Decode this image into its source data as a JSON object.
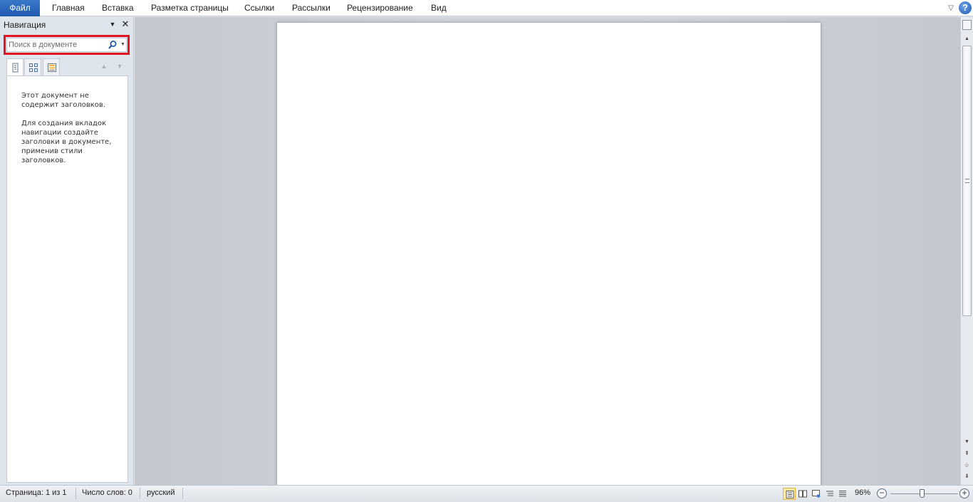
{
  "ribbon": {
    "file_tab": "Файл",
    "tabs": [
      "Главная",
      "Вставка",
      "Разметка страницы",
      "Ссылки",
      "Рассылки",
      "Рецензирование",
      "Вид"
    ],
    "help_icon": "?"
  },
  "navigation": {
    "title": "Навигация",
    "search_placeholder": "Поиск в документе",
    "message_line1": "Этот документ не содержит заголовков.",
    "message_line2": "Для создания вкладок навигации создайте заголовки в документе, применив стили заголовков."
  },
  "statusbar": {
    "page": "Страница: 1 из 1",
    "words": "Число слов: 0",
    "language": "русский",
    "zoom": "96%",
    "zoom_value": 96
  },
  "colors": {
    "file_tab": "#2b6cc4",
    "search_highlight": "#e3151f"
  },
  "icons": [
    "search-icon",
    "help-icon",
    "close-icon",
    "chevron-down-icon",
    "pages-icon",
    "thumbnails-icon",
    "results-icon",
    "zoom-in-icon",
    "zoom-out-icon"
  ]
}
